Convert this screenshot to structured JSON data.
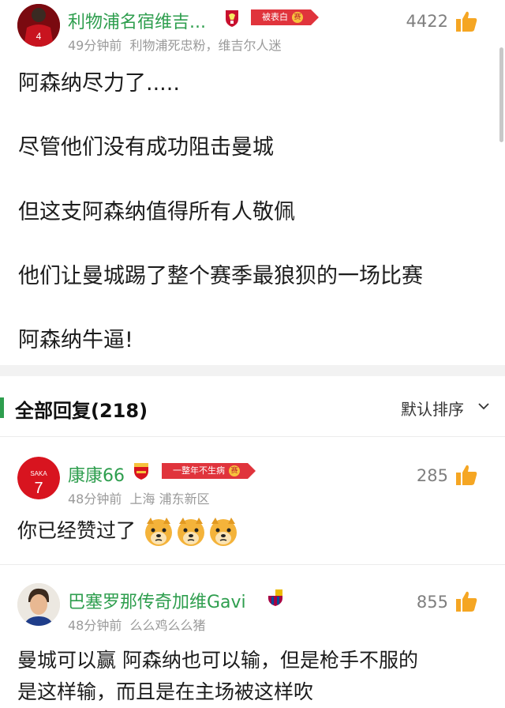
{
  "post": {
    "username": "利物浦名宿维吉...",
    "tag": "被表白",
    "tag_badge": "赛",
    "time": "49分钟前",
    "bio": "利物浦死忠粉，维吉尔人迷",
    "like_count": "4422",
    "avatar_number": "4",
    "lines": [
      "阿森纳尽力了.....",
      "尽管他们没有成功阻击曼城",
      "但这支阿森纳值得所有人敬佩",
      "他们让曼城踢了整个赛季最狼狈的一场比赛",
      "阿森纳牛逼!"
    ]
  },
  "replies_header": {
    "title": "全部回复(218)",
    "sort_label": "默认排序"
  },
  "replies": [
    {
      "username": "康康66",
      "tag": "一整年不生病",
      "tag_badge": "赛",
      "time": "48分钟前",
      "location": "上海 浦东新区",
      "like_count": "285",
      "text": "你已经赞过了",
      "avatar_name": "SAKA",
      "avatar_number": "7"
    },
    {
      "username": "巴塞罗那传奇加维Gavi",
      "time": "48分钟前",
      "bio": "么么鸡么么猪",
      "like_count": "855",
      "text_line1": "曼城可以赢 阿森纳也可以输，但是枪手不服的",
      "text_line2": "是这样输，而且是在主场被这样吹"
    }
  ],
  "colors": {
    "username_green": "#2e9e4e",
    "like_orange": "#f5a623",
    "tag_red": "#e0343c"
  },
  "icons": [
    "thumbs-up-icon",
    "chevron-down-icon",
    "liverpool-crest-icon",
    "arsenal-crest-icon",
    "barcelona-crest-icon",
    "doge-emoji-icon"
  ]
}
